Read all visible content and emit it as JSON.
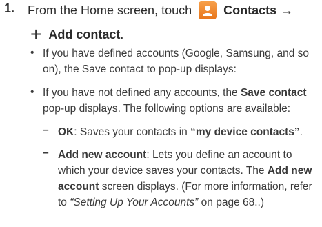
{
  "step": {
    "number": "1.",
    "line1_prefix": "From the Home screen, touch",
    "contacts_label": "Contacts",
    "arrow": "→",
    "plus_symbol": "+",
    "add_contact_label": "Add contact",
    "add_contact_suffix": ".",
    "contacts_icon": "contacts-app-icon"
  },
  "bullets": [
    {
      "marker": "•",
      "text": "If you have defined accounts (Google, Samsung, and so on), the Save contact to pop-up displays:"
    },
    {
      "marker": "•",
      "prefix": "If you have not defined any accounts, the",
      "bold": "Save contact",
      "suffix": "pop-up displays. The following options are available:"
    }
  ],
  "subitems": [
    {
      "marker": "–",
      "label": "OK",
      "text": ": Saves your contacts in",
      "emphasis": "“my device contacts”",
      "end": "."
    },
    {
      "marker": "–",
      "label": "Add new account",
      "text": ": Lets you define an account to which your device saves your contacts. The",
      "bold": "Add new account",
      "text2": "screen displays. (For more information, refer to",
      "ref": "“Setting Up Your Accounts”",
      "page": "on page 68..)"
    }
  ],
  "colors": {
    "contacts_icon_bg": "#e8751a",
    "text": "#2b2b2b"
  }
}
